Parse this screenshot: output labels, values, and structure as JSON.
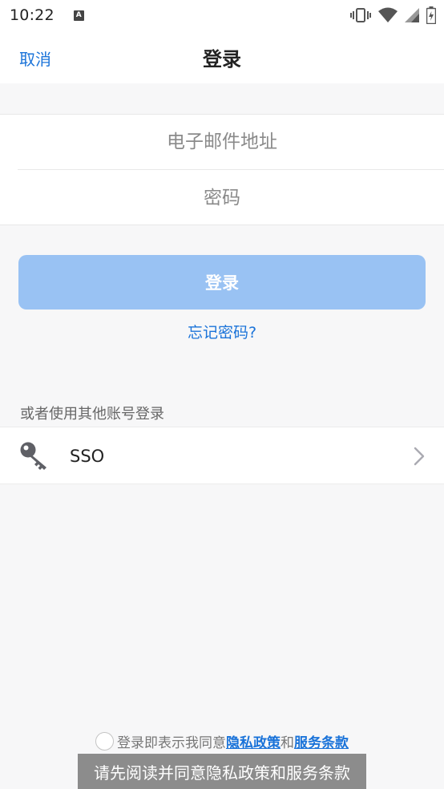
{
  "status_bar": {
    "time": "10:22",
    "notification_icon": "a-icon",
    "right_icons": [
      "vibrate-icon",
      "wifi-icon",
      "signal-icon",
      "battery-icon"
    ]
  },
  "header": {
    "cancel_label": "取消",
    "title": "登录"
  },
  "form": {
    "email_placeholder": "电子邮件地址",
    "email_value": "",
    "password_placeholder": "密码",
    "password_value": ""
  },
  "login_button_label": "登录",
  "forgot_password_label": "忘记密码?",
  "other_login": {
    "section_label": "或者使用其他账号登录",
    "items": [
      {
        "icon": "key-icon",
        "label": "SSO"
      }
    ]
  },
  "agreement": {
    "prefix": "登录即表示我同意",
    "privacy_link": "隐私政策",
    "conjunction": "和",
    "terms_link": "服务条款"
  },
  "toast_message": "请先阅读并同意隐私政策和服务条款",
  "colors": {
    "accent": "#1a73d9",
    "login_button_disabled": "#99c2f3",
    "background": "#f7f7f8",
    "toast_bg": "#8c8c8c"
  }
}
